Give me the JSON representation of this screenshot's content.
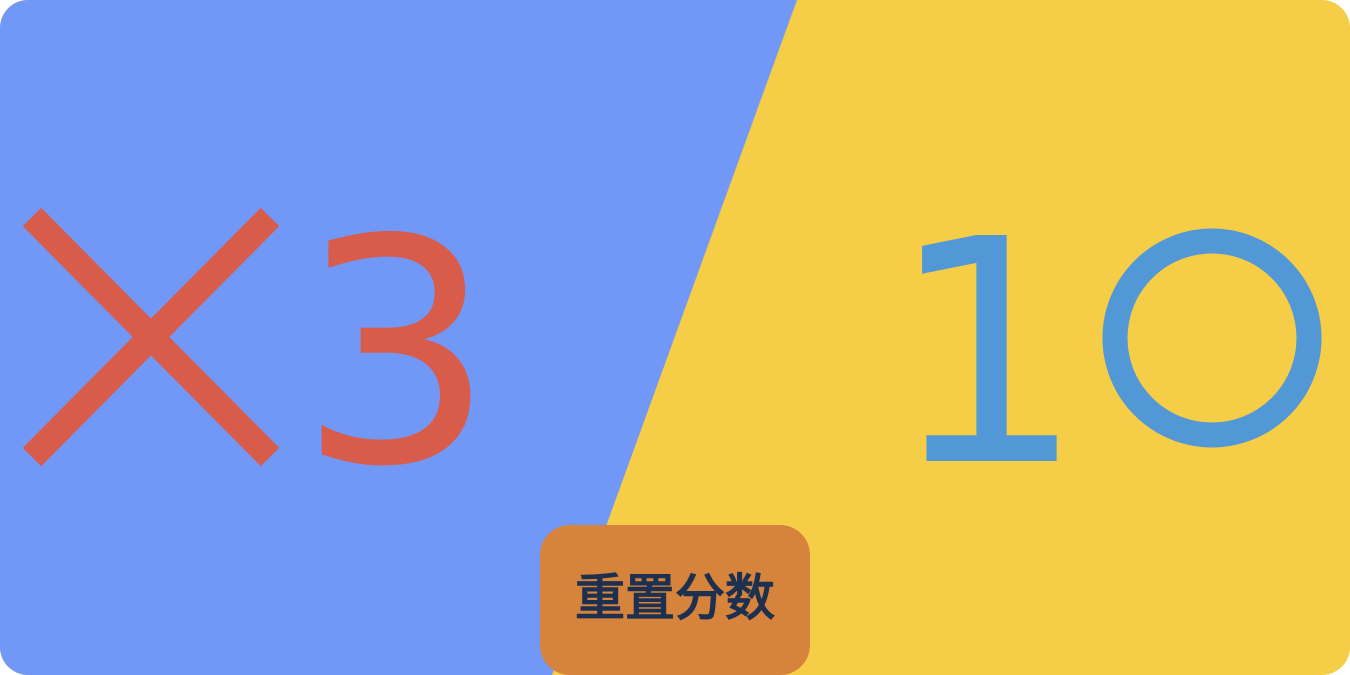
{
  "colors": {
    "player_x_panel": "#7198f6",
    "player_o_panel": "#f6cd46",
    "player_x_mark": "#d95b49",
    "player_o_mark": "#5298d7",
    "reset_button_bg": "#d6843b",
    "reset_button_text": "#1e3050"
  },
  "player_x": {
    "symbol_icon": "x-mark-icon",
    "score": "3"
  },
  "player_o": {
    "symbol_icon": "o-mark-icon",
    "score": "1"
  },
  "reset_button": {
    "label": "重置分数"
  }
}
